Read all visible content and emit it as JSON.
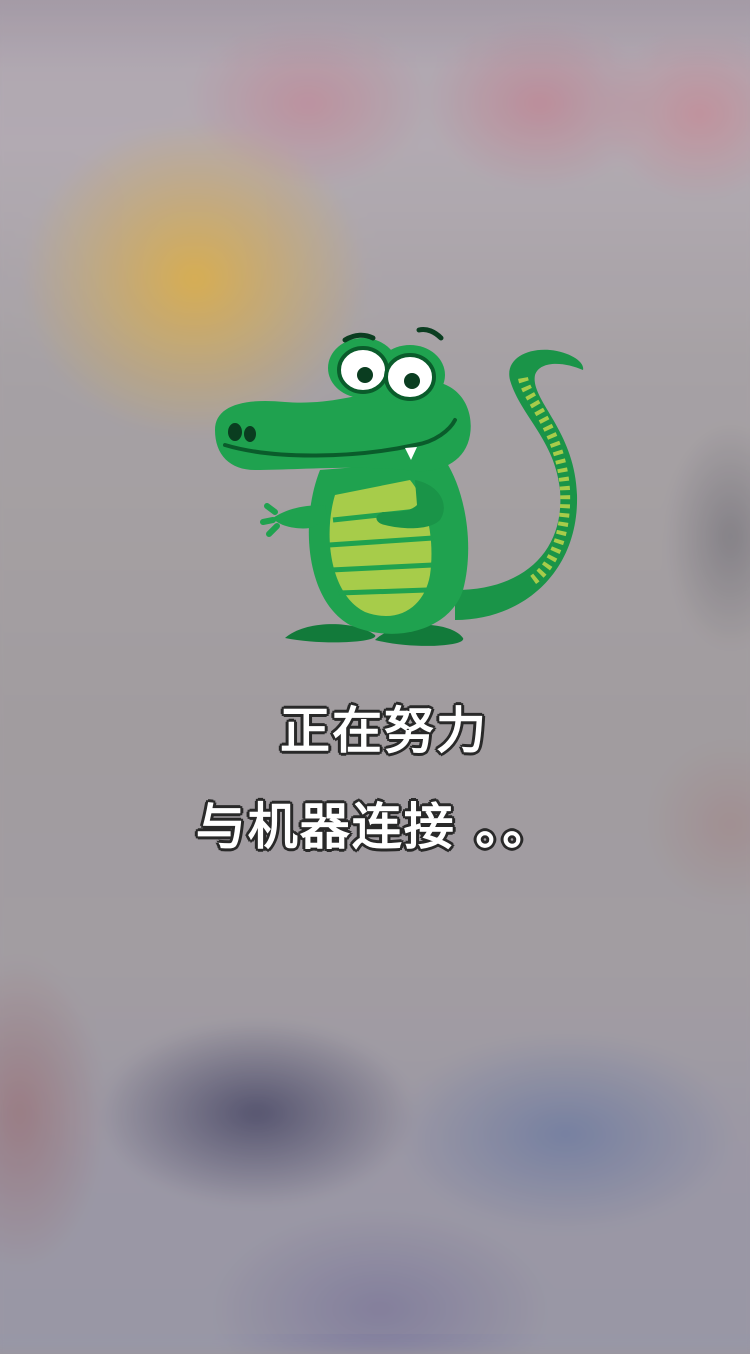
{
  "screen": {
    "loading_message_line1": "正在努力",
    "loading_message_line2": "与机器连接 。。"
  },
  "mascot": {
    "icon": "crocodile-mascot-icon",
    "colors": {
      "body": "#1fa24f",
      "body_dark": "#0f7a3a",
      "belly": "#a7cc4a",
      "outline": "#0a5c2b"
    }
  }
}
